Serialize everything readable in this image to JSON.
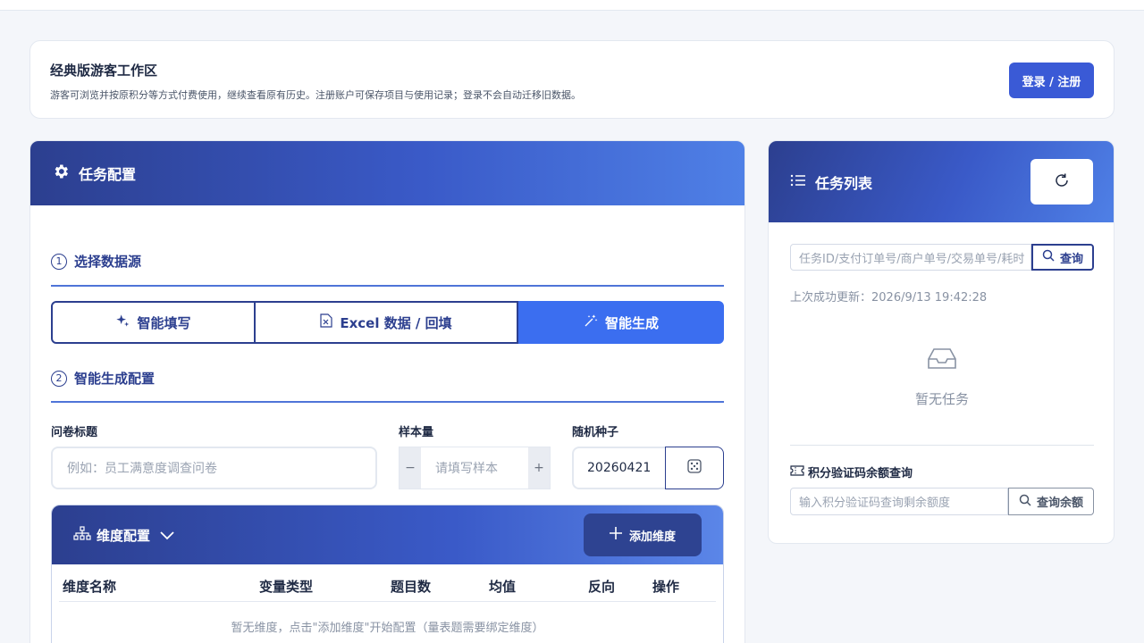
{
  "guest": {
    "title": "经典版游客工作区",
    "description": "游客可浏览并按原积分等方式付费使用，继续查看原有历史。注册账户可保存项目与使用记录；登录不会自动迁移旧数据。",
    "login_label": "登录 / 注册"
  },
  "task_config": {
    "title": "任务配置",
    "section1": {
      "num": "1",
      "label": "选择数据源"
    },
    "source_tabs": [
      {
        "label": "智能填写",
        "icon": "sparkle-icon"
      },
      {
        "label": "Excel 数据 / 回填",
        "icon": "excel-file-icon"
      },
      {
        "label": "智能生成",
        "icon": "magic-wand-icon",
        "active": true
      }
    ],
    "section2": {
      "num": "2",
      "label": "智能生成配置"
    },
    "fields": {
      "title_label": "问卷标题",
      "title_placeholder": "例如：员工满意度调查问卷",
      "sample_label": "样本量",
      "sample_placeholder": "请填写样本",
      "minus": "−",
      "plus": "+",
      "seed_label": "随机种子",
      "seed_value": "20260421"
    },
    "dimensions": {
      "title": "维度配置",
      "add_label": "添加维度",
      "columns": [
        "维度名称",
        "变量类型",
        "题目数",
        "均值",
        "反向",
        "操作"
      ],
      "empty_text": "暂无维度，点击\"添加维度\"开始配置（量表题需要绑定维度）"
    }
  },
  "task_list": {
    "title": "任务列表",
    "search_placeholder": "任务ID/支付订单号/商户单号/交易单号/耗时",
    "search_label": "查询",
    "last_update": "上次成功更新：2026/9/13 19:42:28",
    "empty_text": "暂无任务",
    "points_title": "积分验证码余额查询",
    "points_placeholder": "输入积分验证码查询剩余额度",
    "points_button": "查询余额"
  },
  "colors": {
    "primary_dark": "#2c3f8f",
    "active_tab": "#3b6ef0",
    "login_button": "#3a5ad6"
  }
}
